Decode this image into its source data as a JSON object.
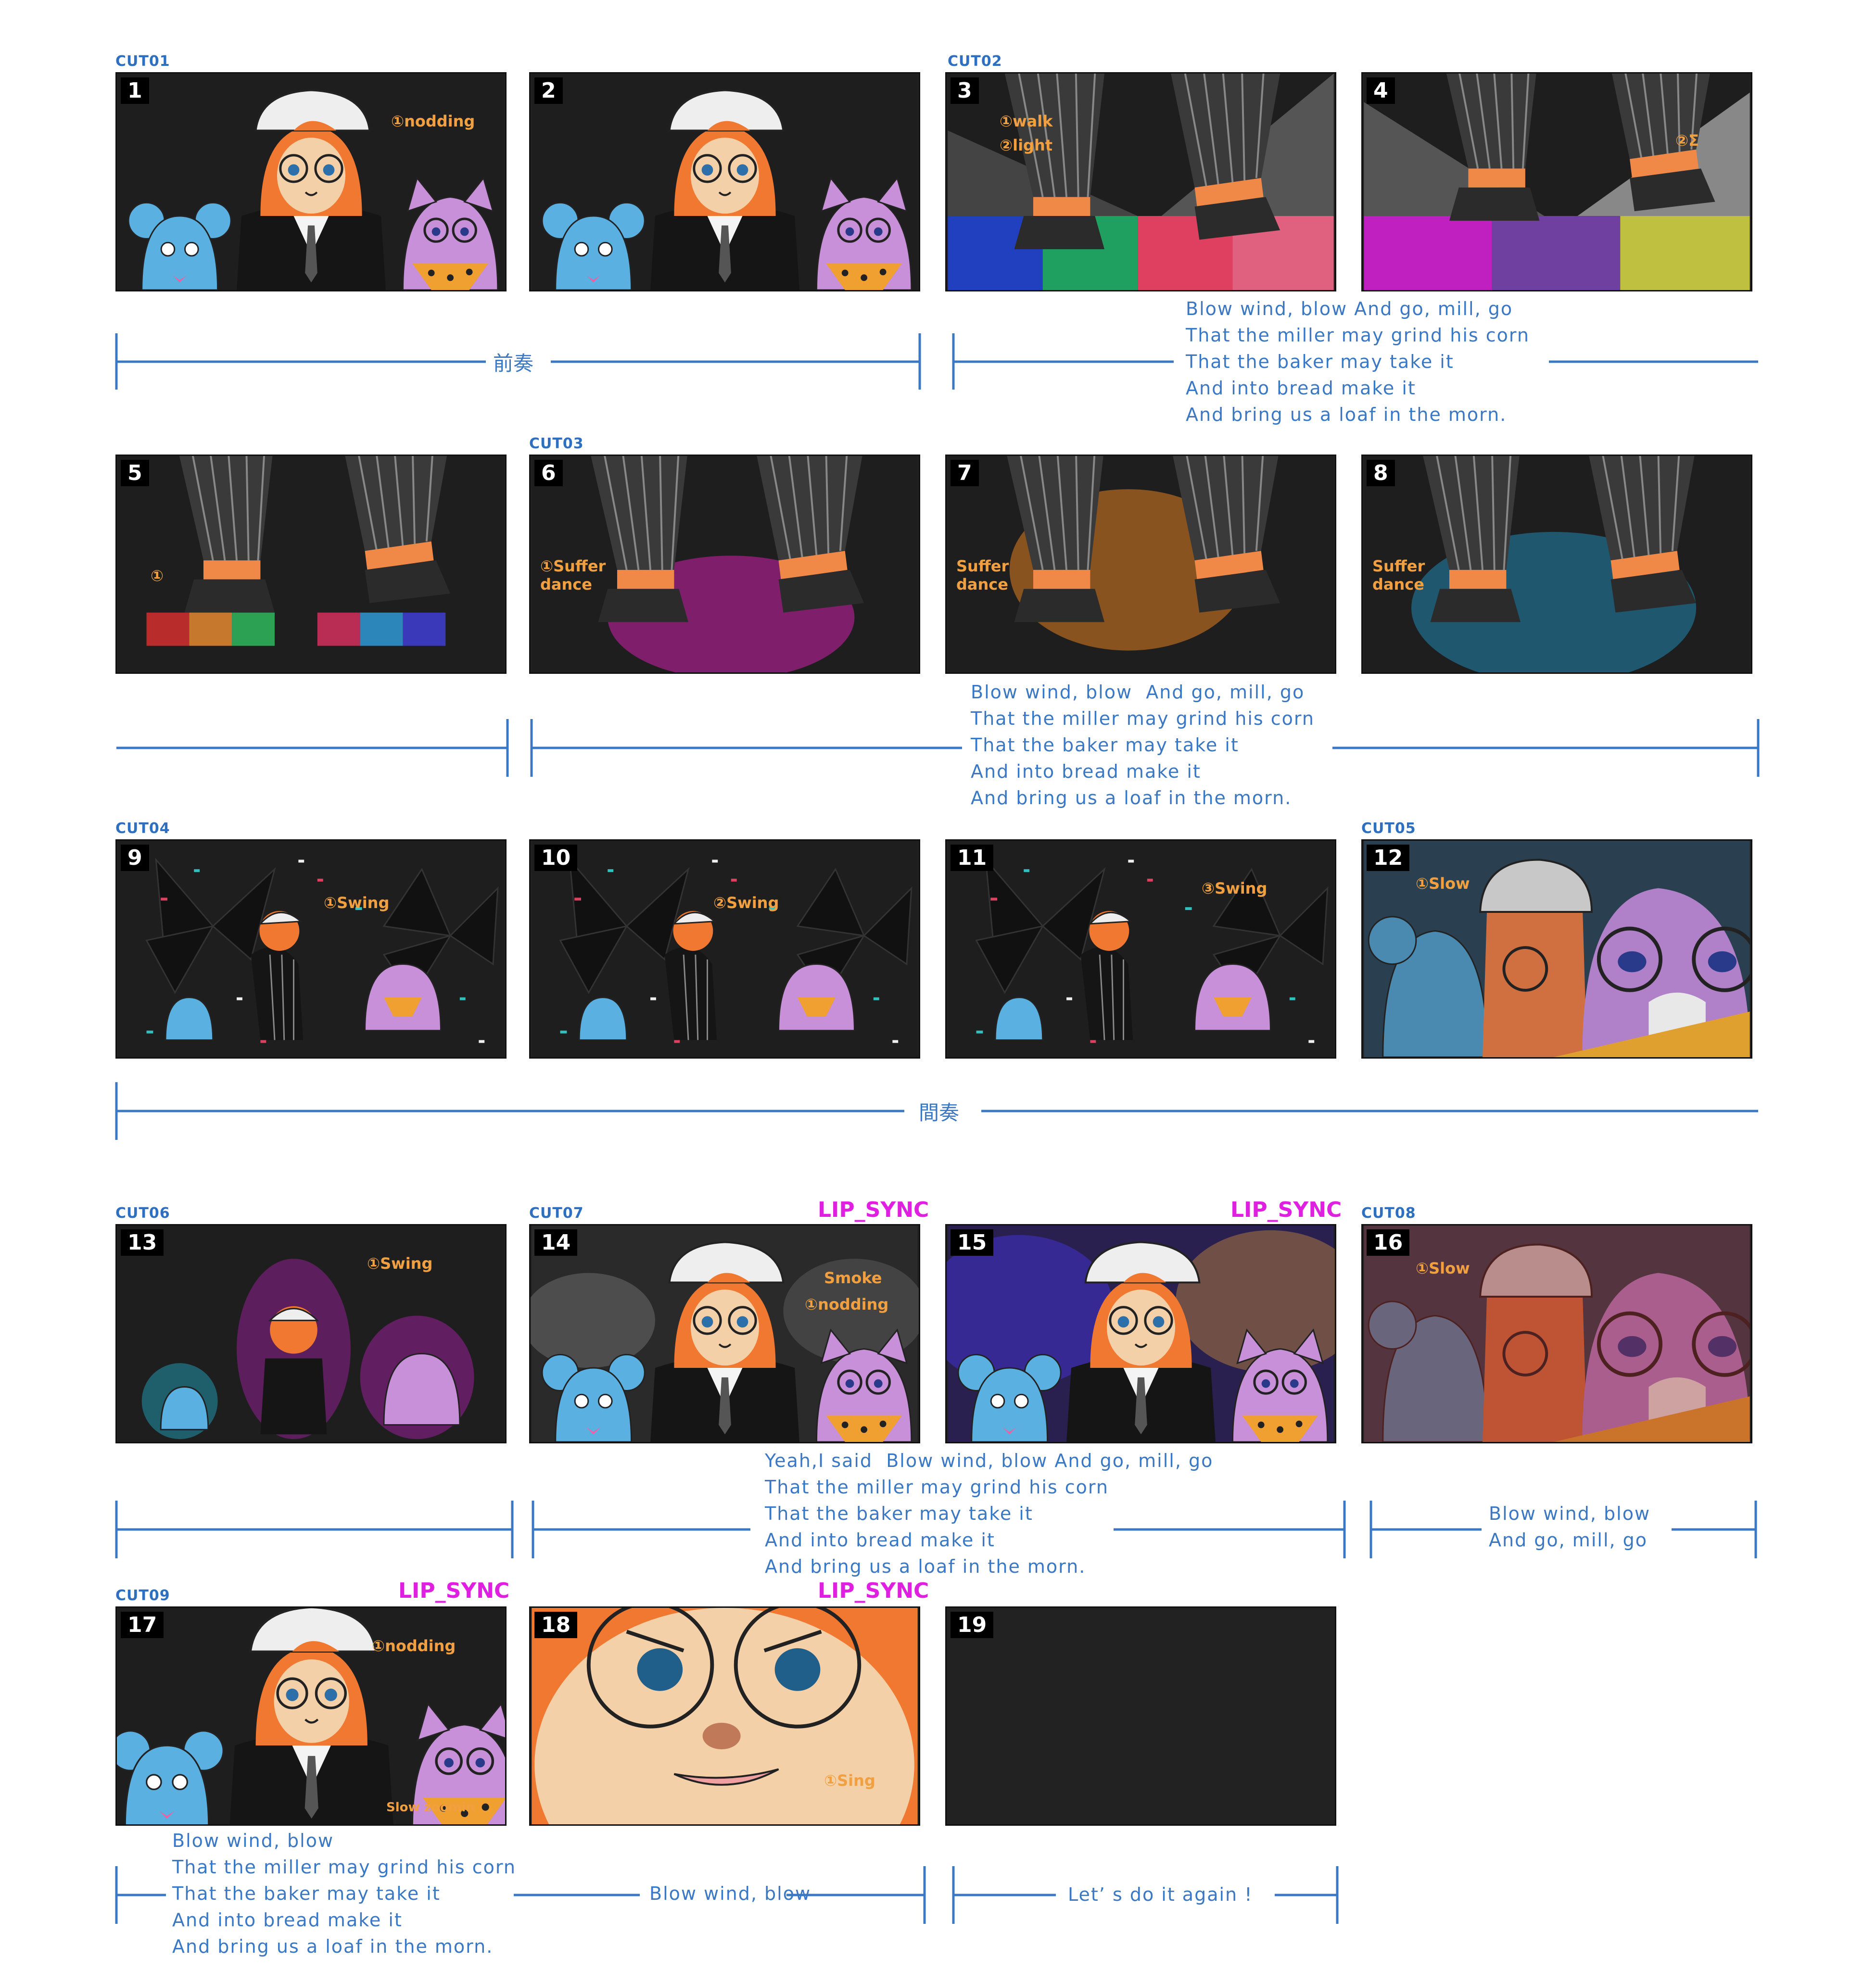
{
  "cuts": {
    "cut01": "CUT01",
    "cut02": "CUT02",
    "cut03": "CUT03",
    "cut04": "CUT04",
    "cut05": "CUT05",
    "cut06": "CUT06",
    "cut07": "CUT07",
    "cut08": "CUT08",
    "cut09": "CUT09"
  },
  "panels": [
    "1",
    "2",
    "3",
    "4",
    "5",
    "6",
    "7",
    "8",
    "9",
    "10",
    "11",
    "12",
    "13",
    "14",
    "15",
    "16",
    "17",
    "18",
    "19"
  ],
  "notes": {
    "p1": "①nodding",
    "p3_walk": "①walk",
    "p3_light": "②light",
    "p4": "②Σ",
    "p5": "①",
    "p6": "①Suffer dance",
    "p7": "Suffer dance",
    "p8": "Suffer dance",
    "p9": "①Swing",
    "p10": "②Swing",
    "p11": "③Swing",
    "p12": "①Slow",
    "p13": "①Swing",
    "p14_smoke": "Smoke",
    "p14_nod": "①nodding",
    "p16": "①Slow",
    "p17_nod": "①nodding",
    "p17_zoom": "Slow zoomin",
    "p18": "①Sing"
  },
  "lip_sync": "LIP_SYNC",
  "sections": {
    "prelude": "前奏",
    "interlude": "間奏"
  },
  "lyrics": {
    "row1": "Blow wind, blow And go, mill, go\nThat the miller may grind his corn\nThat the baker may take it\nAnd into bread make it\nAnd bring us a loaf in the morn.",
    "row2": "Blow wind, blow  And go, mill, go\nThat the miller may grind his corn\nThat the baker may take it\nAnd into bread make it\nAnd bring us a loaf in the morn.",
    "row4": "Yeah,I said  Blow wind, blow And go, mill, go\nThat the miller may grind his corn\nThat the baker may take it\nAnd into bread make it\nAnd bring us a loaf in the morn.",
    "row4_right": "Blow wind, blow\nAnd go, mill, go",
    "row5_left": "Blow wind, blow\nThat the miller may grind his corn\nThat the baker may take it\nAnd into bread make it\nAnd bring us a loaf in the morn.",
    "row5_mid": "Blow wind, blow",
    "row5_right": "Let’ s do it again !"
  },
  "colors": {
    "accent_blue": "#3a78c4",
    "note_orange": "#f0a040",
    "lip_magenta": "#e020e0",
    "panel_bg": "#222222",
    "orange_face": "#f07830"
  }
}
